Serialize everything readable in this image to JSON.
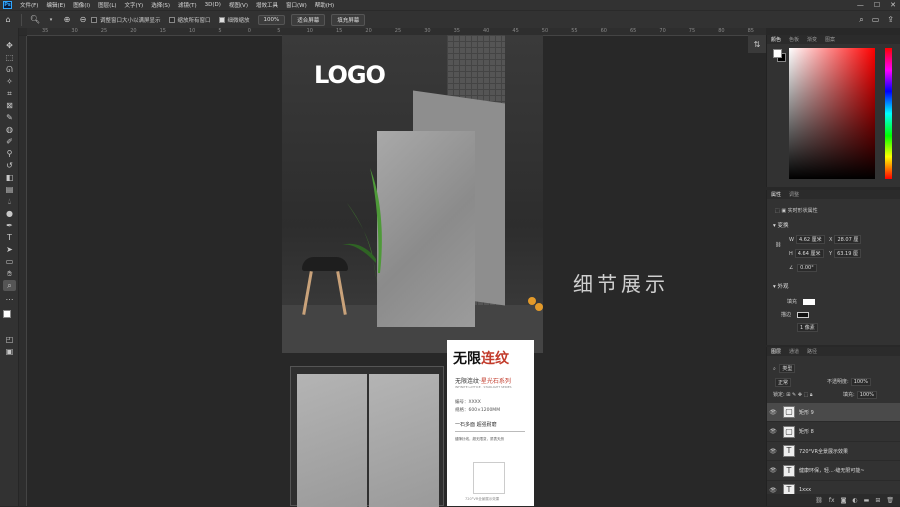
{
  "app": {
    "logo": "Ps"
  },
  "menu": [
    "文件(F)",
    "编辑(E)",
    "图像(I)",
    "图层(L)",
    "文字(Y)",
    "选择(S)",
    "滤镜(T)",
    "3D(D)",
    "视图(V)",
    "增效工具",
    "窗口(W)",
    "帮助(H)"
  ],
  "window_controls": [
    "—",
    "☐",
    "✕"
  ],
  "options": {
    "resize_windows": "调整窗口大小以满屏显示",
    "zoom_all": "缩放所有窗口",
    "scrubby_zoom": "细微缩放",
    "zoom_percent": "100%",
    "fit_screen": "适合屏幕",
    "fill_screen": "填充屏幕"
  },
  "ruler_ticks": [
    "35",
    "30",
    "25",
    "20",
    "15",
    "10",
    "5",
    "0",
    "5",
    "10",
    "15",
    "20",
    "25",
    "30",
    "35",
    "40",
    "45",
    "50",
    "55",
    "60",
    "65",
    "70",
    "75",
    "80",
    "85"
  ],
  "canvas": {
    "logo_text": "LOGO",
    "detail_heading": "细节展示"
  },
  "product_card": {
    "calligraphy_a": "无限",
    "calligraphy_b": "连纹",
    "subtitle_a": "无限连纹·",
    "subtitle_b": "星光石系列",
    "english": "INFINITE LATTICE · STARLIGHT SERIES",
    "model_label": "编号：XXXX",
    "size_label": "规格：600×1200MM",
    "tagline": "一石多面 超强耐磨",
    "desc": "缝隙针线，超无限变，质表天然",
    "footer": "720°VR全景展示效果"
  },
  "color_panel": {
    "tabs": [
      "颜色",
      "色板",
      "渐变",
      "图案"
    ]
  },
  "properties_panel": {
    "tabs": [
      "属性",
      "调整"
    ],
    "layer_kind": "实时形状属性",
    "transform_title": "变换",
    "w_label": "W",
    "w_value": "4.62 厘米",
    "h_label": "H",
    "h_value": "4.64 厘米",
    "x_label": "X",
    "x_value": "28.07 厘",
    "y_label": "Y",
    "y_value": "63.19 厘",
    "angle": "0.00°",
    "appearance_title": "外观",
    "fill_label": "填充",
    "stroke_label": "描边",
    "stroke_width": "1 像素"
  },
  "layers_panel": {
    "tabs": [
      "图层",
      "通道",
      "路径"
    ],
    "filter_kind": "类型",
    "blend_mode": "正常",
    "opacity_label": "不透明度:",
    "opacity_value": "100%",
    "lock_label": "锁定:",
    "fill_label": "填充:",
    "fill_value": "100%",
    "layers": [
      {
        "name": "矩形 9",
        "thumb": "▢",
        "selected": true
      },
      {
        "name": "矩形 8",
        "thumb": "▢",
        "selected": false
      },
      {
        "name": "720°VR全景展示效果",
        "thumb": "T",
        "selected": false
      },
      {
        "name": "健康环保，轻...·缝无限可能~",
        "thumb": "T",
        "selected": false
      },
      {
        "name": "1xxx",
        "thumb": "T",
        "selected": false
      }
    ]
  }
}
